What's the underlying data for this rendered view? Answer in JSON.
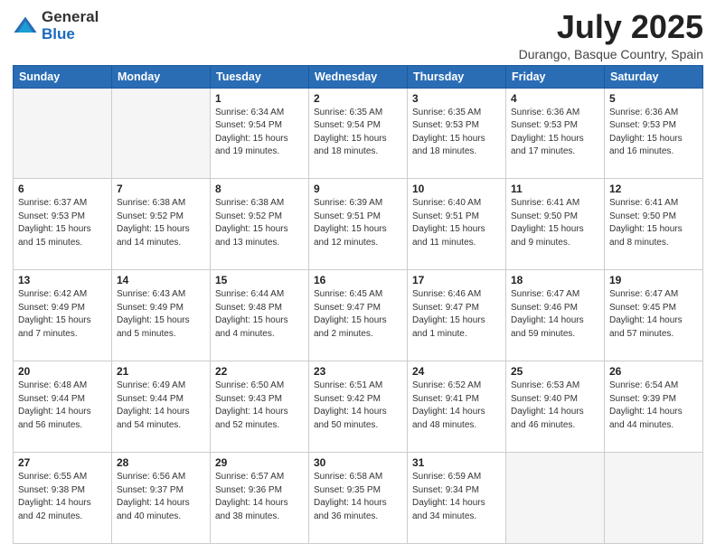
{
  "logo": {
    "general": "General",
    "blue": "Blue"
  },
  "title": "July 2025",
  "location": "Durango, Basque Country, Spain",
  "days_of_week": [
    "Sunday",
    "Monday",
    "Tuesday",
    "Wednesday",
    "Thursday",
    "Friday",
    "Saturday"
  ],
  "weeks": [
    [
      {
        "day": "",
        "info": ""
      },
      {
        "day": "",
        "info": ""
      },
      {
        "day": "1",
        "info": "Sunrise: 6:34 AM\nSunset: 9:54 PM\nDaylight: 15 hours\nand 19 minutes."
      },
      {
        "day": "2",
        "info": "Sunrise: 6:35 AM\nSunset: 9:54 PM\nDaylight: 15 hours\nand 18 minutes."
      },
      {
        "day": "3",
        "info": "Sunrise: 6:35 AM\nSunset: 9:53 PM\nDaylight: 15 hours\nand 18 minutes."
      },
      {
        "day": "4",
        "info": "Sunrise: 6:36 AM\nSunset: 9:53 PM\nDaylight: 15 hours\nand 17 minutes."
      },
      {
        "day": "5",
        "info": "Sunrise: 6:36 AM\nSunset: 9:53 PM\nDaylight: 15 hours\nand 16 minutes."
      }
    ],
    [
      {
        "day": "6",
        "info": "Sunrise: 6:37 AM\nSunset: 9:53 PM\nDaylight: 15 hours\nand 15 minutes."
      },
      {
        "day": "7",
        "info": "Sunrise: 6:38 AM\nSunset: 9:52 PM\nDaylight: 15 hours\nand 14 minutes."
      },
      {
        "day": "8",
        "info": "Sunrise: 6:38 AM\nSunset: 9:52 PM\nDaylight: 15 hours\nand 13 minutes."
      },
      {
        "day": "9",
        "info": "Sunrise: 6:39 AM\nSunset: 9:51 PM\nDaylight: 15 hours\nand 12 minutes."
      },
      {
        "day": "10",
        "info": "Sunrise: 6:40 AM\nSunset: 9:51 PM\nDaylight: 15 hours\nand 11 minutes."
      },
      {
        "day": "11",
        "info": "Sunrise: 6:41 AM\nSunset: 9:50 PM\nDaylight: 15 hours\nand 9 minutes."
      },
      {
        "day": "12",
        "info": "Sunrise: 6:41 AM\nSunset: 9:50 PM\nDaylight: 15 hours\nand 8 minutes."
      }
    ],
    [
      {
        "day": "13",
        "info": "Sunrise: 6:42 AM\nSunset: 9:49 PM\nDaylight: 15 hours\nand 7 minutes."
      },
      {
        "day": "14",
        "info": "Sunrise: 6:43 AM\nSunset: 9:49 PM\nDaylight: 15 hours\nand 5 minutes."
      },
      {
        "day": "15",
        "info": "Sunrise: 6:44 AM\nSunset: 9:48 PM\nDaylight: 15 hours\nand 4 minutes."
      },
      {
        "day": "16",
        "info": "Sunrise: 6:45 AM\nSunset: 9:47 PM\nDaylight: 15 hours\nand 2 minutes."
      },
      {
        "day": "17",
        "info": "Sunrise: 6:46 AM\nSunset: 9:47 PM\nDaylight: 15 hours\nand 1 minute."
      },
      {
        "day": "18",
        "info": "Sunrise: 6:47 AM\nSunset: 9:46 PM\nDaylight: 14 hours\nand 59 minutes."
      },
      {
        "day": "19",
        "info": "Sunrise: 6:47 AM\nSunset: 9:45 PM\nDaylight: 14 hours\nand 57 minutes."
      }
    ],
    [
      {
        "day": "20",
        "info": "Sunrise: 6:48 AM\nSunset: 9:44 PM\nDaylight: 14 hours\nand 56 minutes."
      },
      {
        "day": "21",
        "info": "Sunrise: 6:49 AM\nSunset: 9:44 PM\nDaylight: 14 hours\nand 54 minutes."
      },
      {
        "day": "22",
        "info": "Sunrise: 6:50 AM\nSunset: 9:43 PM\nDaylight: 14 hours\nand 52 minutes."
      },
      {
        "day": "23",
        "info": "Sunrise: 6:51 AM\nSunset: 9:42 PM\nDaylight: 14 hours\nand 50 minutes."
      },
      {
        "day": "24",
        "info": "Sunrise: 6:52 AM\nSunset: 9:41 PM\nDaylight: 14 hours\nand 48 minutes."
      },
      {
        "day": "25",
        "info": "Sunrise: 6:53 AM\nSunset: 9:40 PM\nDaylight: 14 hours\nand 46 minutes."
      },
      {
        "day": "26",
        "info": "Sunrise: 6:54 AM\nSunset: 9:39 PM\nDaylight: 14 hours\nand 44 minutes."
      }
    ],
    [
      {
        "day": "27",
        "info": "Sunrise: 6:55 AM\nSunset: 9:38 PM\nDaylight: 14 hours\nand 42 minutes."
      },
      {
        "day": "28",
        "info": "Sunrise: 6:56 AM\nSunset: 9:37 PM\nDaylight: 14 hours\nand 40 minutes."
      },
      {
        "day": "29",
        "info": "Sunrise: 6:57 AM\nSunset: 9:36 PM\nDaylight: 14 hours\nand 38 minutes."
      },
      {
        "day": "30",
        "info": "Sunrise: 6:58 AM\nSunset: 9:35 PM\nDaylight: 14 hours\nand 36 minutes."
      },
      {
        "day": "31",
        "info": "Sunrise: 6:59 AM\nSunset: 9:34 PM\nDaylight: 14 hours\nand 34 minutes."
      },
      {
        "day": "",
        "info": ""
      },
      {
        "day": "",
        "info": ""
      }
    ]
  ]
}
